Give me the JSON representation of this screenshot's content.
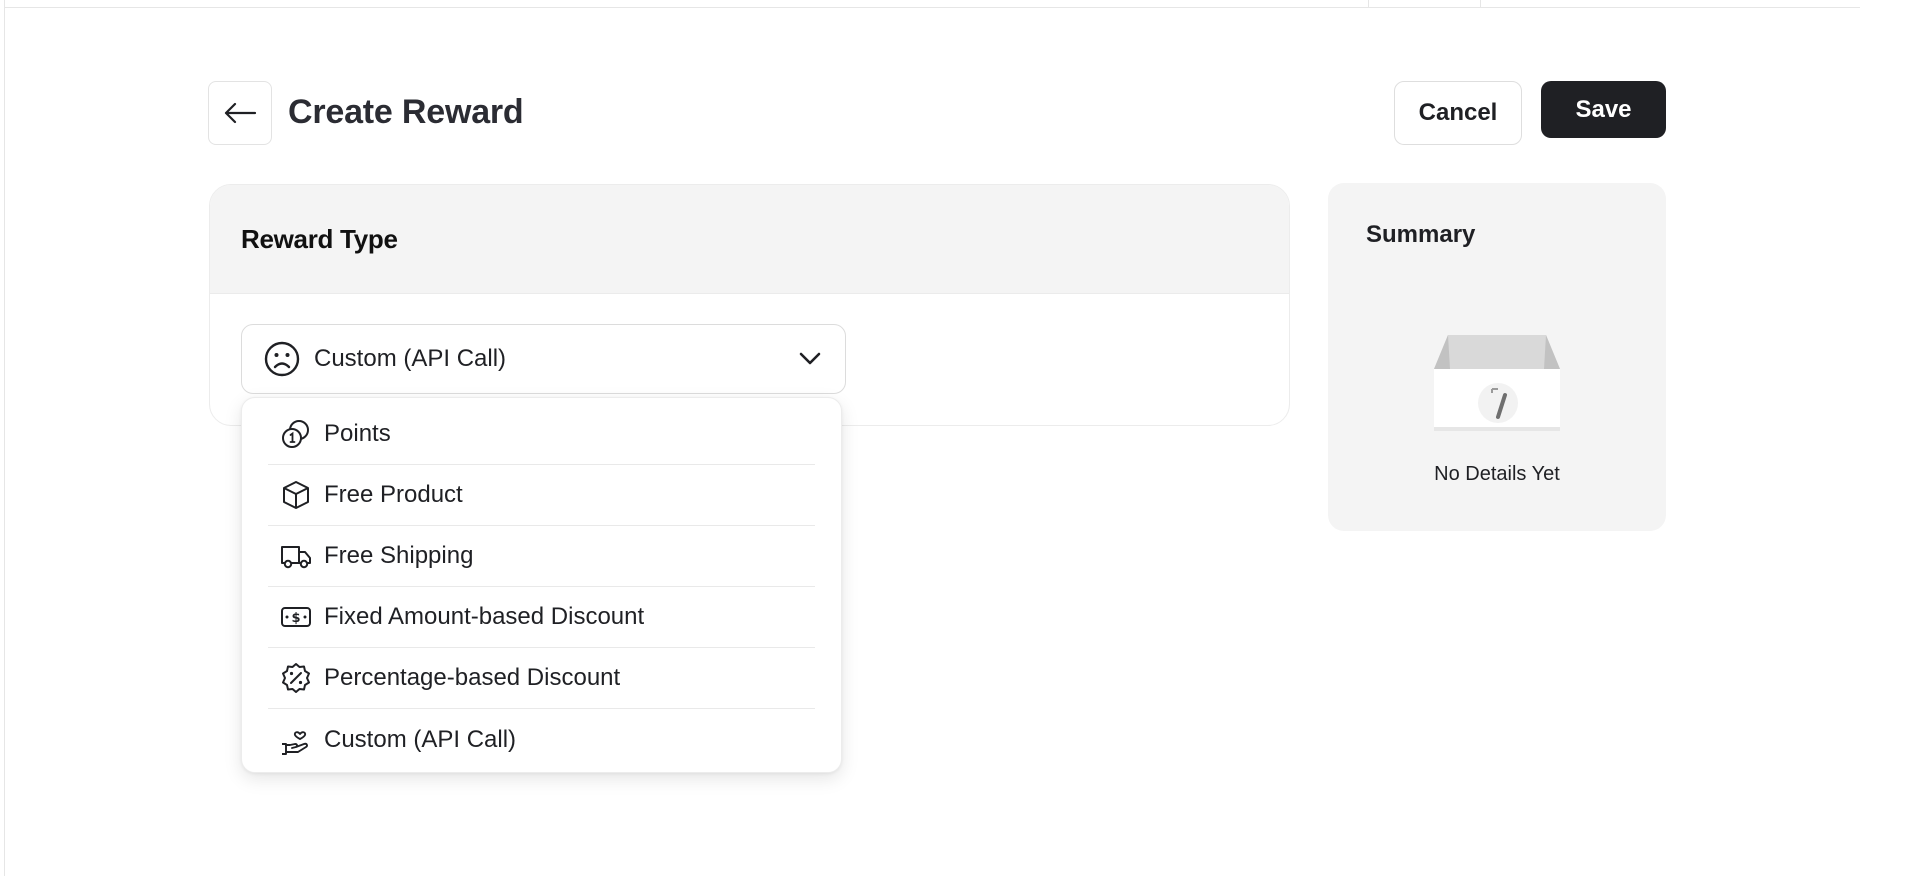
{
  "header": {
    "title": "Create Reward",
    "cancel_label": "Cancel",
    "save_label": "Save",
    "back_icon": "arrow-left-icon"
  },
  "reward_type": {
    "title": "Reward Type",
    "selected": {
      "label": "Custom (API Call)",
      "icon": "frown-face-icon"
    },
    "options": [
      {
        "label": "Points",
        "icon": "coins-icon"
      },
      {
        "label": "Free Product",
        "icon": "box-icon"
      },
      {
        "label": "Free Shipping",
        "icon": "truck-icon"
      },
      {
        "label": "Fixed Amount-based Discount",
        "icon": "banknote-icon"
      },
      {
        "label": "Percentage-based Discount",
        "icon": "percent-badge-icon"
      },
      {
        "label": "Custom (API Call)",
        "icon": "hand-heart-icon"
      }
    ]
  },
  "summary": {
    "title": "Summary",
    "empty_text": "No Details Yet"
  },
  "colors": {
    "primary_button": "#1f2024",
    "card_header_bg": "#f4f4f4",
    "summary_bg": "#f4f4f4"
  }
}
